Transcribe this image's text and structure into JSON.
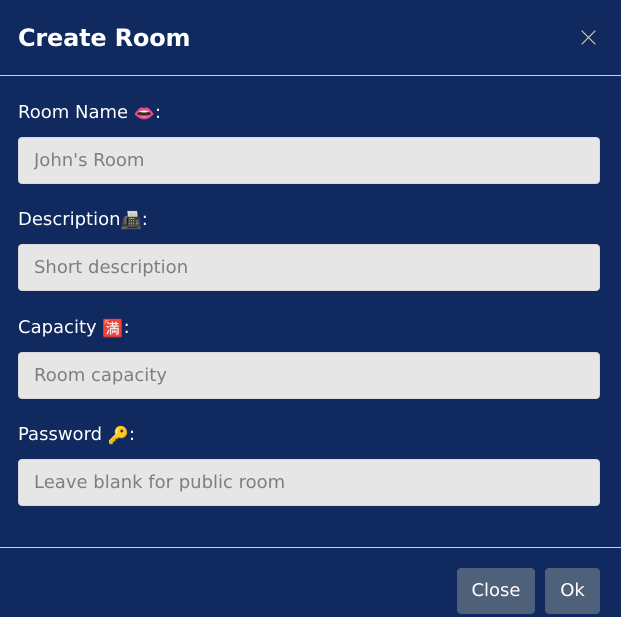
{
  "dialog": {
    "title": "Create Room",
    "close_icon": "close-icon"
  },
  "fields": {
    "room_name": {
      "label": "Room Name",
      "emoji": "👄",
      "suffix": ":",
      "value": "",
      "placeholder": "John's Room"
    },
    "description": {
      "label": "Description",
      "emoji": "📠",
      "suffix": ":",
      "value": "",
      "placeholder": "Short description"
    },
    "capacity": {
      "label": "Capacity",
      "emoji": "🈵",
      "suffix": ":",
      "value": "",
      "placeholder": "Room capacity"
    },
    "password": {
      "label": "Password",
      "emoji": "🔑",
      "suffix": ":",
      "value": "",
      "placeholder": "Leave blank for public room"
    }
  },
  "footer": {
    "close_label": "Close",
    "ok_label": "Ok"
  },
  "colors": {
    "background": "#10295f",
    "input_background": "#e6e6e6",
    "button_background": "#4f6079",
    "text": "#ffffff"
  }
}
